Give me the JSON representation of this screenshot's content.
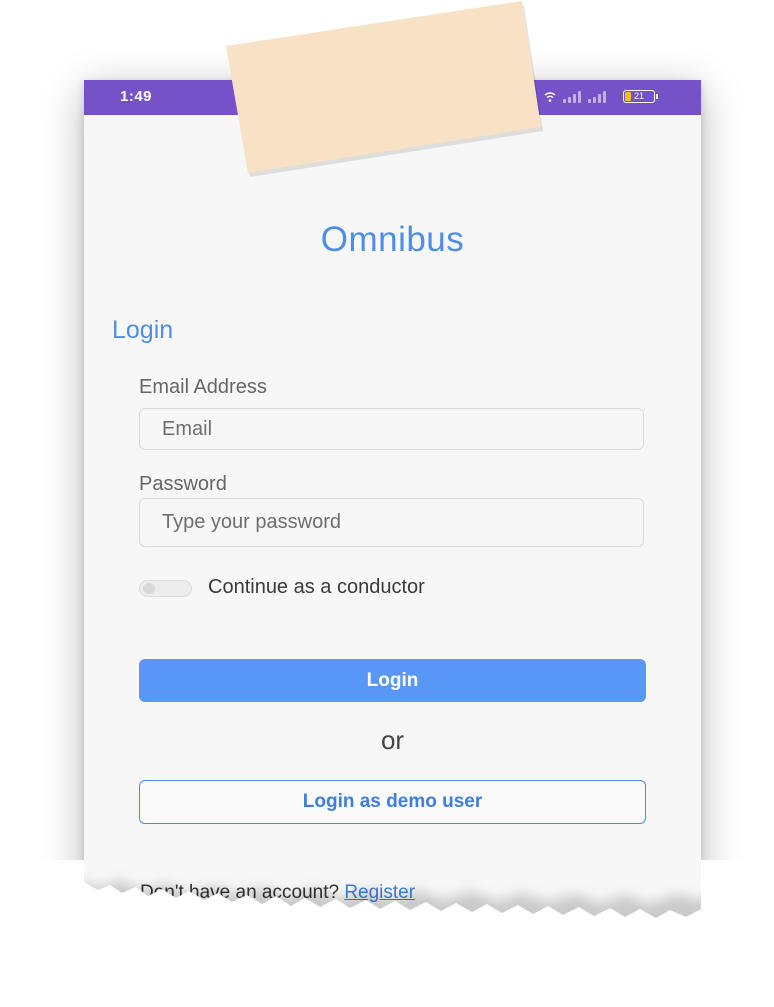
{
  "statusbar": {
    "time": "1:49",
    "battery": "21"
  },
  "app": {
    "title": "Omnibus"
  },
  "login": {
    "heading": "Login",
    "email_label": "Email Address",
    "email_placeholder": "Email",
    "password_label": "Password",
    "password_placeholder": "Type your password",
    "conductor_toggle_label": "Continue as a conductor",
    "conductor_toggle_on": false,
    "login_button": "Login",
    "or_text": "or",
    "demo_button": "Login as demo user",
    "register_prompt": "Don't have an account?",
    "register_link": "Register"
  },
  "colors": {
    "statusbar": "#7652c8",
    "accent": "#4f8ee8",
    "primary_button": "#5897f5",
    "sticky_note": "#f8e2c6"
  },
  "icons": [
    "wifi-icon",
    "signal-icon",
    "battery-icon"
  ]
}
